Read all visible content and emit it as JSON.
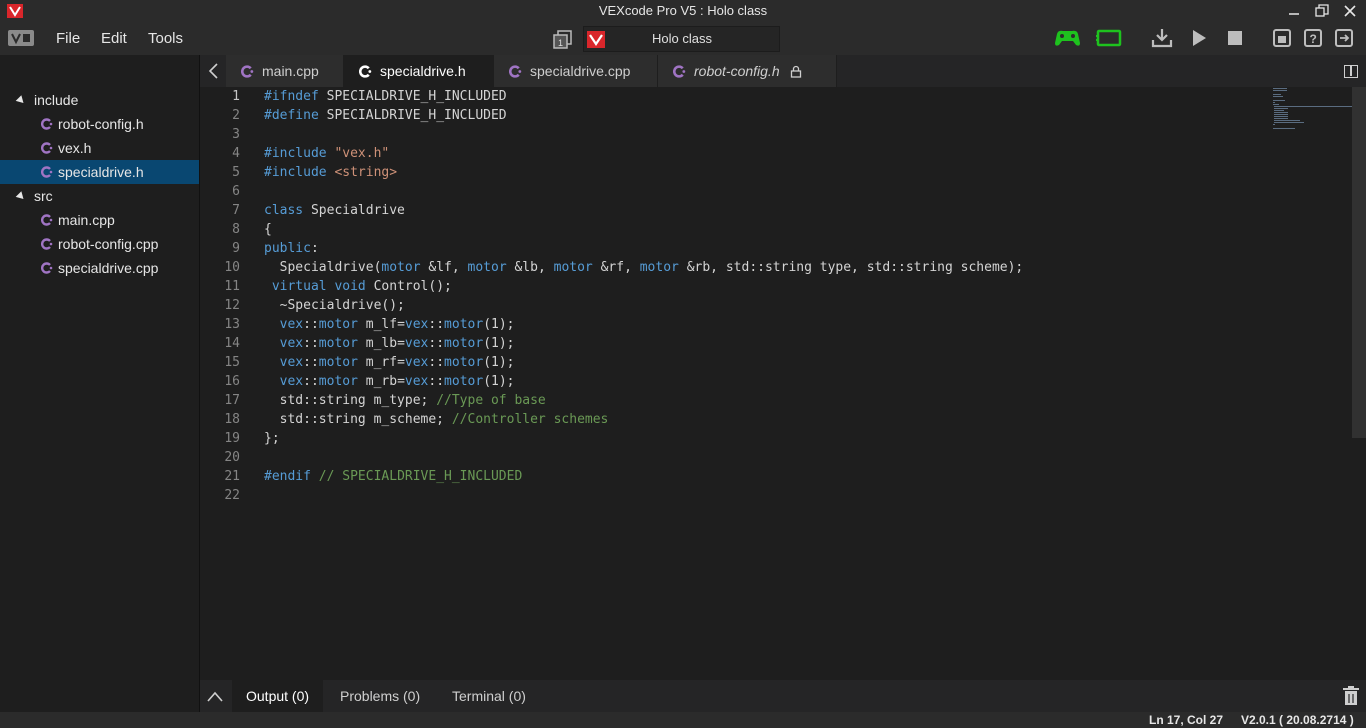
{
  "window": {
    "title": "VEXcode Pro V5 : Holo class"
  },
  "menu": {
    "file": "File",
    "edit": "Edit",
    "tools": "Tools"
  },
  "project": {
    "name": "Holo class"
  },
  "toolbar": {
    "icons": [
      "controller-icon",
      "brain-icon",
      "download-icon",
      "play-icon",
      "stop-icon",
      "slot-icon",
      "help-icon",
      "exit-icon"
    ],
    "accent_green": "#1ec21e"
  },
  "sidebar": {
    "folders": [
      {
        "label": "include",
        "files": [
          "robot-config.h",
          "vex.h",
          "specialdrive.h"
        ]
      },
      {
        "label": "src",
        "files": [
          "main.cpp",
          "robot-config.cpp",
          "specialdrive.cpp"
        ]
      }
    ],
    "selected_file": "specialdrive.h",
    "selected_color": "#094771"
  },
  "tabs": [
    {
      "label": "main.cpp",
      "active": false,
      "locked": false
    },
    {
      "label": "specialdrive.h",
      "active": true,
      "locked": false
    },
    {
      "label": "specialdrive.cpp",
      "active": false,
      "locked": false
    },
    {
      "label": "robot-config.h",
      "active": false,
      "locked": true
    }
  ],
  "editor": {
    "line_numbers": [
      "1",
      "2",
      "3",
      "4",
      "5",
      "6",
      "7",
      "8",
      "9",
      "10",
      "11",
      "12",
      "13",
      "14",
      "15",
      "16",
      "17",
      "18",
      "19",
      "20",
      "21",
      "22"
    ],
    "current_line": 1
  },
  "bottom_panel": {
    "output": "Output (0)",
    "problems": "Problems (0)",
    "terminal": "Terminal (0)"
  },
  "status": {
    "position": "Ln 17, Col 27",
    "version": "V2.0.1 ( 20.08.2714 )"
  }
}
